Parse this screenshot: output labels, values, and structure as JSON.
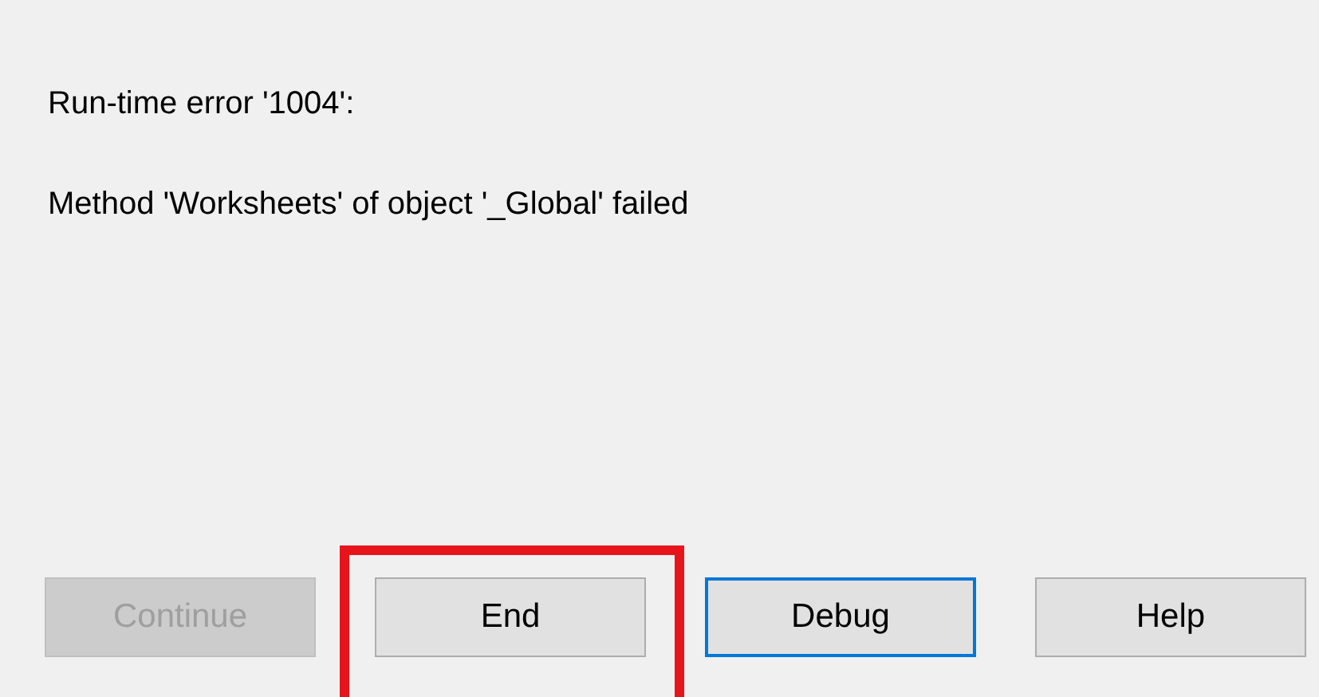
{
  "message": {
    "title": "Run-time error '1004':",
    "detail": "Method 'Worksheets' of object '_Global' failed"
  },
  "buttons": [
    {
      "label": "Continue",
      "disabled": true,
      "default": false,
      "highlighted": false
    },
    {
      "label": "End",
      "disabled": false,
      "default": false,
      "highlighted": true
    },
    {
      "label": "Debug",
      "disabled": false,
      "default": true,
      "highlighted": false
    },
    {
      "label": "Help",
      "disabled": false,
      "default": false,
      "highlighted": false
    }
  ]
}
